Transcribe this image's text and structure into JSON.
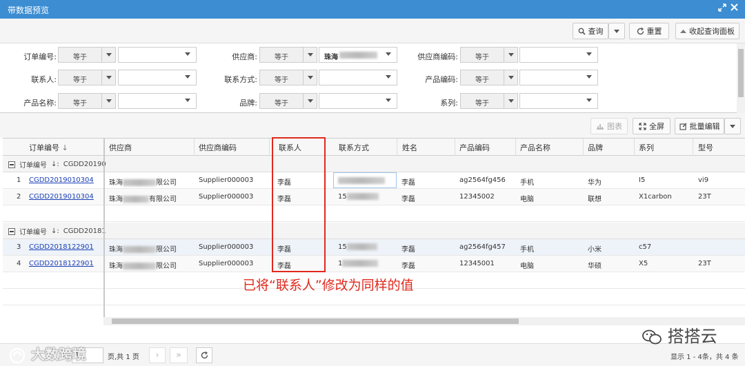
{
  "window": {
    "title": "带数据预览",
    "maximize_icon": "expand-icon",
    "close_icon": "close-icon"
  },
  "toolbar": {
    "query_label": "查询",
    "reset_label": "重置",
    "collapse_label": "收起查询面板"
  },
  "filters": [
    {
      "label": "订单编号:",
      "operator": "等于",
      "value": ""
    },
    {
      "label": "供应商:",
      "operator": "等于",
      "value": "珠海"
    },
    {
      "label": "供应商编码:",
      "operator": "等于",
      "value": ""
    },
    {
      "label": "联系人:",
      "operator": "等于",
      "value": ""
    },
    {
      "label": "联系方式:",
      "operator": "等于",
      "value": ""
    },
    {
      "label": "产品编码:",
      "operator": "等于",
      "value": ""
    },
    {
      "label": "产品名称:",
      "operator": "等于",
      "value": ""
    },
    {
      "label": "品牌:",
      "operator": "等于",
      "value": ""
    },
    {
      "label": "系列:",
      "operator": "等于",
      "value": ""
    }
  ],
  "grid_toolbar": {
    "chart_label": "图表",
    "fullscreen_label": "全屏",
    "batch_edit_label": "批量编辑"
  },
  "columns": [
    "订单编号",
    "供应商",
    "供应商编码",
    "联系人",
    "联系方式",
    "姓名",
    "产品编码",
    "产品名称",
    "品牌",
    "系列",
    "型号"
  ],
  "groups": [
    {
      "label": "订单编号",
      "value": "CGDD20190",
      "rows": [
        {
          "num": "1",
          "order": "CGDD2019010304",
          "supplier_a": "珠海",
          "supplier_b": "限公司",
          "supplier_code": "Supplier000003",
          "contact": "李磊",
          "phone": "",
          "name": "李磊",
          "product_code": "ag2564fg456",
          "product_name": "手机",
          "brand": "华为",
          "series": "I5",
          "model": "vi9"
        },
        {
          "num": "2",
          "order": "CGDD2019010304",
          "supplier_a": "珠海",
          "supplier_b": "有限公司",
          "supplier_code": "Supplier000003",
          "contact": "李磊",
          "phone": "15",
          "name": "李磊",
          "product_code": "12345002",
          "product_name": "电脑",
          "brand": "联想",
          "series": "X1carbon",
          "model": "23T"
        }
      ]
    },
    {
      "label": "订单编号",
      "value": "CGDD20181",
      "rows": [
        {
          "num": "3",
          "order": "CGDD2018122901",
          "supplier_a": "珠海",
          "supplier_b": "限公司",
          "supplier_code": "Supplier000003",
          "contact": "李磊",
          "phone": "15",
          "name": "李磊",
          "product_code": "ag2564fg457",
          "product_name": "手机",
          "brand": "小米",
          "series": "c57",
          "model": ""
        },
        {
          "num": "4",
          "order": "CGDD2018122901",
          "supplier_a": "珠海",
          "supplier_b": "限公司",
          "supplier_code": "Supplier000003",
          "contact": "李磊",
          "phone": "1",
          "name": "李磊",
          "product_code": "12345001",
          "product_name": "电脑",
          "brand": "华硕",
          "series": "X5",
          "model": "23T"
        }
      ]
    }
  ],
  "annotation": "已将“联系人”修改为同样的值",
  "pager": {
    "current_page": "1",
    "page_suffix": "页,共 1 页",
    "summary": "显示 1 - 4条，共 4 条"
  },
  "watermarks": {
    "left": "大数跨境",
    "right": "搭搭云"
  },
  "colors": {
    "titlebar": "#3c8dd1",
    "highlight": "#e0281c",
    "link": "#1a3fb5"
  }
}
